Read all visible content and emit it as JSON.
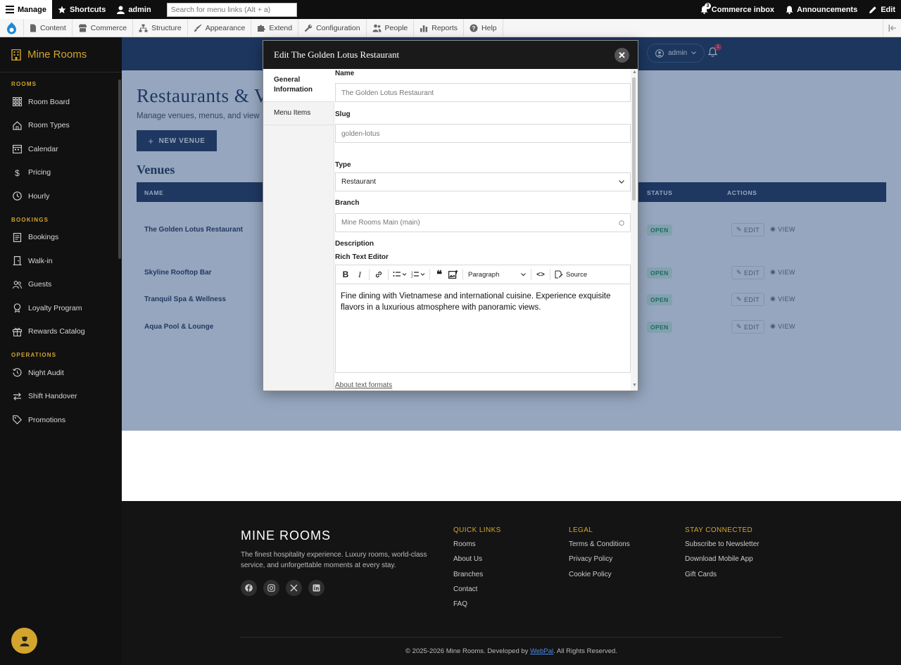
{
  "toolbar": {
    "manage": "Manage",
    "shortcuts": "Shortcuts",
    "user": "admin",
    "search_placeholder": "Search for menu links (Alt + a)",
    "commerce_inbox": "Commerce inbox",
    "commerce_inbox_count": "3",
    "announcements": "Announcements",
    "edit": "Edit"
  },
  "tray": [
    "Content",
    "Commerce",
    "Structure",
    "Appearance",
    "Extend",
    "Configuration",
    "People",
    "Reports",
    "Help"
  ],
  "sidebar": {
    "brand": "Mine Rooms",
    "sections": [
      {
        "title": "ROOMS",
        "items": [
          "Room Board",
          "Room Types",
          "Calendar",
          "Pricing",
          "Hourly"
        ]
      },
      {
        "title": "BOOKINGS",
        "items": [
          "Bookings",
          "Walk-in",
          "Guests",
          "Loyalty Program",
          "Rewards Catalog"
        ]
      },
      {
        "title": "OPERATIONS",
        "items": [
          "Night Audit",
          "Shift Handover",
          "Promotions"
        ]
      }
    ]
  },
  "header": {
    "user": "admin",
    "notification_count": "1"
  },
  "page": {
    "title": "Restaurants & V",
    "subtitle": "Manage venues, menus, and view",
    "new_button": "NEW VENUE",
    "venues_title": "Venues",
    "columns": {
      "name": "NAME",
      "status": "STATUS",
      "actions": "ACTIONS"
    },
    "rows": [
      {
        "name": "The Golden Lotus Restaurant",
        "status": "OPEN"
      },
      {
        "name": "Skyline Rooftop Bar",
        "status": "OPEN"
      },
      {
        "name": "Tranquil Spa & Wellness",
        "status": "OPEN"
      },
      {
        "name": "Aqua Pool & Lounge",
        "status": "OPEN"
      }
    ],
    "edit_label": "EDIT",
    "view_label": "VIEW"
  },
  "modal": {
    "title": "Edit The Golden Lotus Restaurant",
    "tabs": [
      "General Information",
      "Menu Items"
    ],
    "name_label": "Name",
    "name_value": "The Golden Lotus Restaurant",
    "slug_label": "Slug",
    "slug_value": "golden-lotus",
    "type_label": "Type",
    "type_value": "Restaurant",
    "branch_label": "Branch",
    "branch_value": "Mine Rooms Main (main)",
    "description_label": "Description",
    "editor_label": "Rich Text Editor",
    "paragraph_label": "Paragraph",
    "source_label": "Source",
    "editor_content": "Fine dining with Vietnamese and international cuisine. Experience exquisite flavors in a luxurious atmosphere with panoramic views.",
    "about_formats": "About text formats"
  },
  "footer": {
    "brand": "MINE ROOMS",
    "description": "The finest hospitality experience. Luxury rooms, world-class service, and unforgettable moments at every stay.",
    "columns": [
      {
        "title": "QUICK LINKS",
        "links": [
          "Rooms",
          "About Us",
          "Branches",
          "Contact",
          "FAQ"
        ]
      },
      {
        "title": "LEGAL",
        "links": [
          "Terms & Conditions",
          "Privacy Policy",
          "Cookie Policy"
        ]
      },
      {
        "title": "STAY CONNECTED",
        "links": [
          "Subscribe to Newsletter",
          "Download Mobile App",
          "Gift Cards"
        ]
      }
    ],
    "copyright_prefix": "© 2025-2026 Mine Rooms. Developed by ",
    "developer": "WebPal",
    "copyright_suffix": ". All Rights Reserved."
  },
  "colors": {
    "accent": "#d4a52c",
    "navy": "#1b2d4d",
    "open_badge": "#1b8a4a"
  }
}
